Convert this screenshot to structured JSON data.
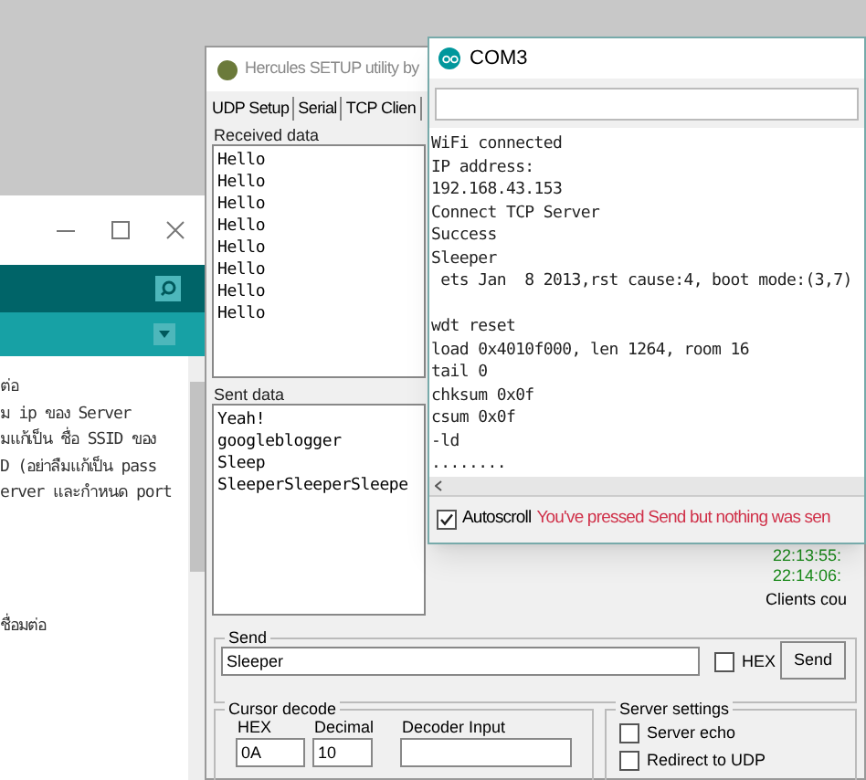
{
  "arduino_ide": {
    "editor_lines": [
      "ต่อ",
      "ม ip ของ Server",
      "มแก้เป็น ชื่อ SSID ของ",
      "D (อย่าลืมแก้เป็น pass",
      "erver และกำหนด port"
    ],
    "editor_lines_lower": [
      "ชื่อมต่อ"
    ]
  },
  "hercules": {
    "title": "Hercules SETUP utility by",
    "tabs": [
      {
        "label": "UDP Setup",
        "selected": false
      },
      {
        "label": "Serial",
        "selected": false
      },
      {
        "label": "TCP Clien",
        "selected": false
      }
    ],
    "received_label": "Received data",
    "received": [
      "Hello",
      "Hello",
      "Hello",
      "Hello",
      "Hello",
      "Hello",
      "Hello",
      "Hello"
    ],
    "sent_label": "Sent data",
    "sent": [
      "Yeah!",
      "googleblogger",
      "Sleep",
      "SleeperSleeperSleepe"
    ],
    "log": [
      "22:13:55:",
      "22:14:06:"
    ],
    "clients_label": "Clients cou",
    "send_group": "Send",
    "send_value": "Sleeper",
    "hex": {
      "label": "HEX",
      "checked": false
    },
    "send_button": "Send",
    "cursor_group": "Cursor decode",
    "cursor_fields": [
      {
        "label": "HEX",
        "value": "0A"
      },
      {
        "label": "Decimal",
        "value": "10"
      },
      {
        "label": "Decoder Input"
      }
    ],
    "server_group": "Server settings",
    "server_options": [
      {
        "label": "Server echo",
        "checked": false
      },
      {
        "label": "Redirect to UDP",
        "checked": false
      }
    ]
  },
  "serial_monitor": {
    "title": "COM3",
    "output": [
      "WiFi connected",
      "IP address:",
      "192.168.43.153",
      "Connect TCP Server",
      "Success",
      "Sleeper",
      " ets Jan  8 2013,rst cause:4, boot mode:(3,7)"
    ],
    "output_after_blank": [
      "wdt reset",
      "load 0x4010f000, len 1264, room 16",
      "tail 0",
      "chksum 0x0f",
      "csum 0x0f",
      "-ld",
      "........"
    ],
    "autoscroll": {
      "label": "Autoscroll",
      "checked": true
    },
    "message": "You've pressed Send but nothing was sen"
  }
}
